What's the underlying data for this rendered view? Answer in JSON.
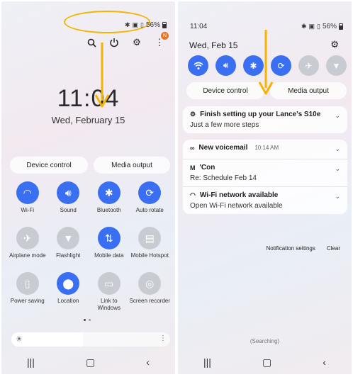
{
  "left": {
    "status": {
      "battery": "56%"
    },
    "clock": "11:04",
    "date": "Wed, February 15",
    "badge": "N",
    "pills": {
      "device_control": "Device control",
      "media_output": "Media output"
    },
    "tiles": [
      {
        "label": "Wi-Fi",
        "icon": "wifi-icon",
        "on": true
      },
      {
        "label": "Sound",
        "icon": "sound-icon",
        "on": true
      },
      {
        "label": "Bluetooth",
        "icon": "bluetooth-icon",
        "on": true
      },
      {
        "label": "Auto rotate",
        "icon": "auto-rotate-icon",
        "on": true
      },
      {
        "label": "Airplane mode",
        "icon": "airplane-icon",
        "on": false
      },
      {
        "label": "Flashlight",
        "icon": "flashlight-icon",
        "on": false
      },
      {
        "label": "Mobile data",
        "icon": "mobile-data-icon",
        "on": true
      },
      {
        "label": "Mobile Hotspot",
        "icon": "hotspot-icon",
        "on": false
      },
      {
        "label": "Power saving",
        "icon": "power-saving-icon",
        "on": false
      },
      {
        "label": "Location",
        "icon": "location-icon",
        "on": true
      },
      {
        "label": "Link to Windows",
        "icon": "link-windows-icon",
        "on": false
      },
      {
        "label": "Screen recorder",
        "icon": "screen-recorder-icon",
        "on": false
      }
    ],
    "brightness": 0.45
  },
  "right": {
    "time": "11:04",
    "battery": "56%",
    "date": "Wed, Feb 15",
    "pills": {
      "device_control": "Device control",
      "media_output": "Media output"
    },
    "setup": {
      "title": "Finish setting up your Lance's S10e",
      "sub": "Just a few more steps"
    },
    "notifications": [
      {
        "icon": "voicemail-icon",
        "title": "New voicemail",
        "time": "10:14 AM",
        "sub": ""
      },
      {
        "icon": "gmail-icon",
        "title": "'Con",
        "time": "",
        "sub": "Re: Schedule Feb 14"
      },
      {
        "icon": "wifi-icon",
        "title": "Wi-Fi network available",
        "time": "",
        "sub": "Open Wi-Fi network available"
      }
    ],
    "actions": {
      "settings": "Notification settings",
      "clear": "Clear"
    },
    "searching": "(Searching)"
  },
  "colors": {
    "accent": "#3a6ff2",
    "highlight": "#f4b400"
  }
}
